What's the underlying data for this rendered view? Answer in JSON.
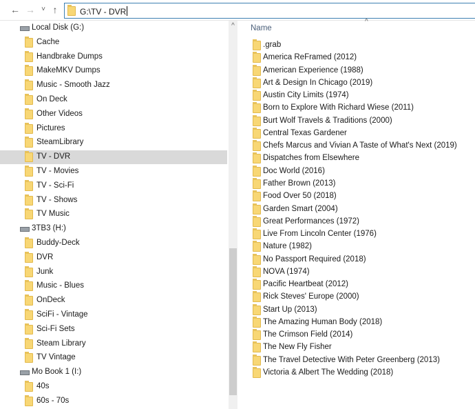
{
  "address": {
    "path": "G:\\TV - DVR"
  },
  "nav_buttons": {
    "back": "←",
    "forward": "→",
    "recent": "˅",
    "up": "↑"
  },
  "nav_tree": [
    {
      "label": "Local Disk (G:)",
      "type": "drive"
    },
    {
      "label": "Cache",
      "type": "folder"
    },
    {
      "label": "Handbrake Dumps",
      "type": "folder"
    },
    {
      "label": "MakeMKV Dumps",
      "type": "folder"
    },
    {
      "label": "Music - Smooth Jazz",
      "type": "folder"
    },
    {
      "label": "On Deck",
      "type": "folder"
    },
    {
      "label": "Other Videos",
      "type": "folder"
    },
    {
      "label": "Pictures",
      "type": "folder"
    },
    {
      "label": "SteamLibrary",
      "type": "folder"
    },
    {
      "label": "TV - DVR",
      "type": "folder",
      "selected": true
    },
    {
      "label": "TV - Movies",
      "type": "folder"
    },
    {
      "label": "TV - Sci-Fi",
      "type": "folder"
    },
    {
      "label": "TV - Shows",
      "type": "folder"
    },
    {
      "label": "TV Music",
      "type": "folder"
    },
    {
      "label": "3TB3 (H:)",
      "type": "drive"
    },
    {
      "label": "Buddy-Deck",
      "type": "folder"
    },
    {
      "label": "DVR",
      "type": "folder"
    },
    {
      "label": "Junk",
      "type": "folder"
    },
    {
      "label": "Music - Blues",
      "type": "folder"
    },
    {
      "label": "OnDeck",
      "type": "folder"
    },
    {
      "label": "SciFi - Vintage",
      "type": "folder"
    },
    {
      "label": "Sci-Fi Sets",
      "type": "folder"
    },
    {
      "label": "Steam Library",
      "type": "folder"
    },
    {
      "label": "TV Vintage",
      "type": "folder"
    },
    {
      "label": "Mo Book 1 (I:)",
      "type": "drive"
    },
    {
      "label": "40s",
      "type": "folder"
    },
    {
      "label": "60s - 70s",
      "type": "folder"
    }
  ],
  "file_list": {
    "column_header": "Name",
    "sort_indicator": "^",
    "items": [
      ".grab",
      "America ReFramed (2012)",
      "American Experience (1988)",
      "Art & Design In Chicago (2019)",
      "Austin City Limits (1974)",
      "Born to Explore With Richard Wiese (2011)",
      "Burt Wolf Travels & Traditions (2000)",
      "Central Texas Gardener",
      "Chefs Marcus and Vivian A Taste of What's Next (2019)",
      "Dispatches from Elsewhere",
      "Doc World (2016)",
      "Father Brown (2013)",
      "Food Over 50 (2018)",
      "Garden Smart (2004)",
      "Great Performances (1972)",
      "Live From Lincoln Center (1976)",
      "Nature (1982)",
      "No Passport Required (2018)",
      "NOVA (1974)",
      "Pacific Heartbeat (2012)",
      "Rick Steves' Europe (2000)",
      "Start Up (2013)",
      "The Amazing Human Body (2018)",
      "The Crimson Field (2014)",
      "The New Fly Fisher",
      "The Travel Detective With Peter Greenberg (2013)",
      "Victoria & Albert The Wedding (2018)"
    ]
  },
  "scrollbar": {
    "up_arrow": "^",
    "position_fraction": 0.7
  }
}
